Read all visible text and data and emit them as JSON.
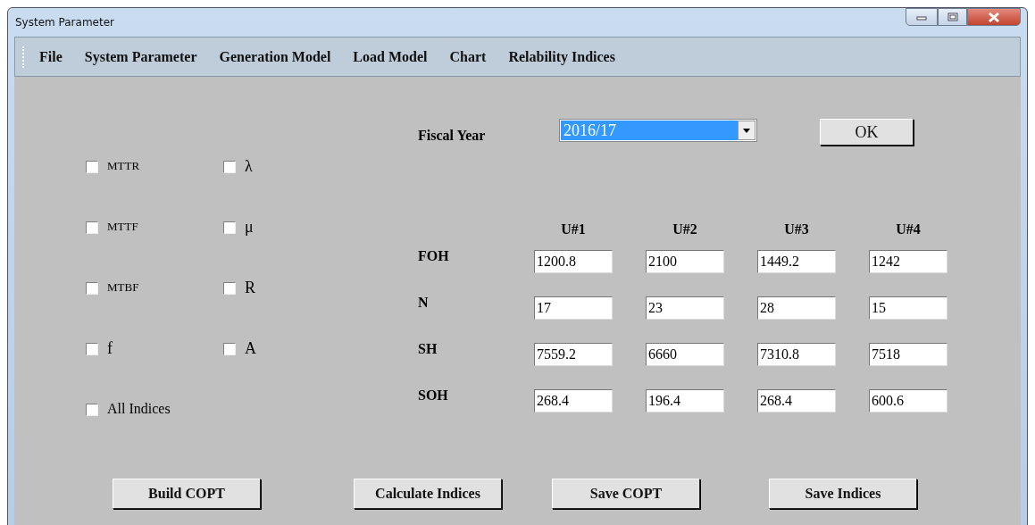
{
  "window": {
    "title": "System Parameter"
  },
  "menu": [
    "File",
    "System Parameter",
    "Generation Model",
    "Load Model",
    "Chart",
    "Relability Indices"
  ],
  "indices": [
    {
      "label": "MTTR",
      "checked": false
    },
    {
      "label": "λ",
      "checked": false
    },
    {
      "label": "MTTF",
      "checked": false
    },
    {
      "label": "μ",
      "checked": false
    },
    {
      "label": "MTBF",
      "checked": false
    },
    {
      "label": "R",
      "checked": false
    },
    {
      "label": "f",
      "checked": false
    },
    {
      "label": "A",
      "checked": false
    }
  ],
  "all_indices": {
    "label": "All Indices",
    "checked": false
  },
  "fiscal_year": {
    "label": "Fiscal Year",
    "value": "2016/17"
  },
  "ok_button": "OK",
  "table": {
    "columns": [
      "U#1",
      "U#2",
      "U#3",
      "U#4"
    ],
    "rows": [
      {
        "label": "FOH",
        "values": [
          "1200.8",
          "2100",
          "1449.2",
          "1242"
        ]
      },
      {
        "label": "N",
        "values": [
          "17",
          "23",
          "28",
          "15"
        ]
      },
      {
        "label": "SH",
        "values": [
          "7559.2",
          "6660",
          "7310.8",
          "7518"
        ]
      },
      {
        "label": "SOH",
        "values": [
          "268.4",
          "196.4",
          "268.4",
          "600.6"
        ]
      }
    ]
  },
  "buttons": [
    "Build COPT",
    "Calculate Indices",
    "Save COPT",
    "Save Indices"
  ]
}
